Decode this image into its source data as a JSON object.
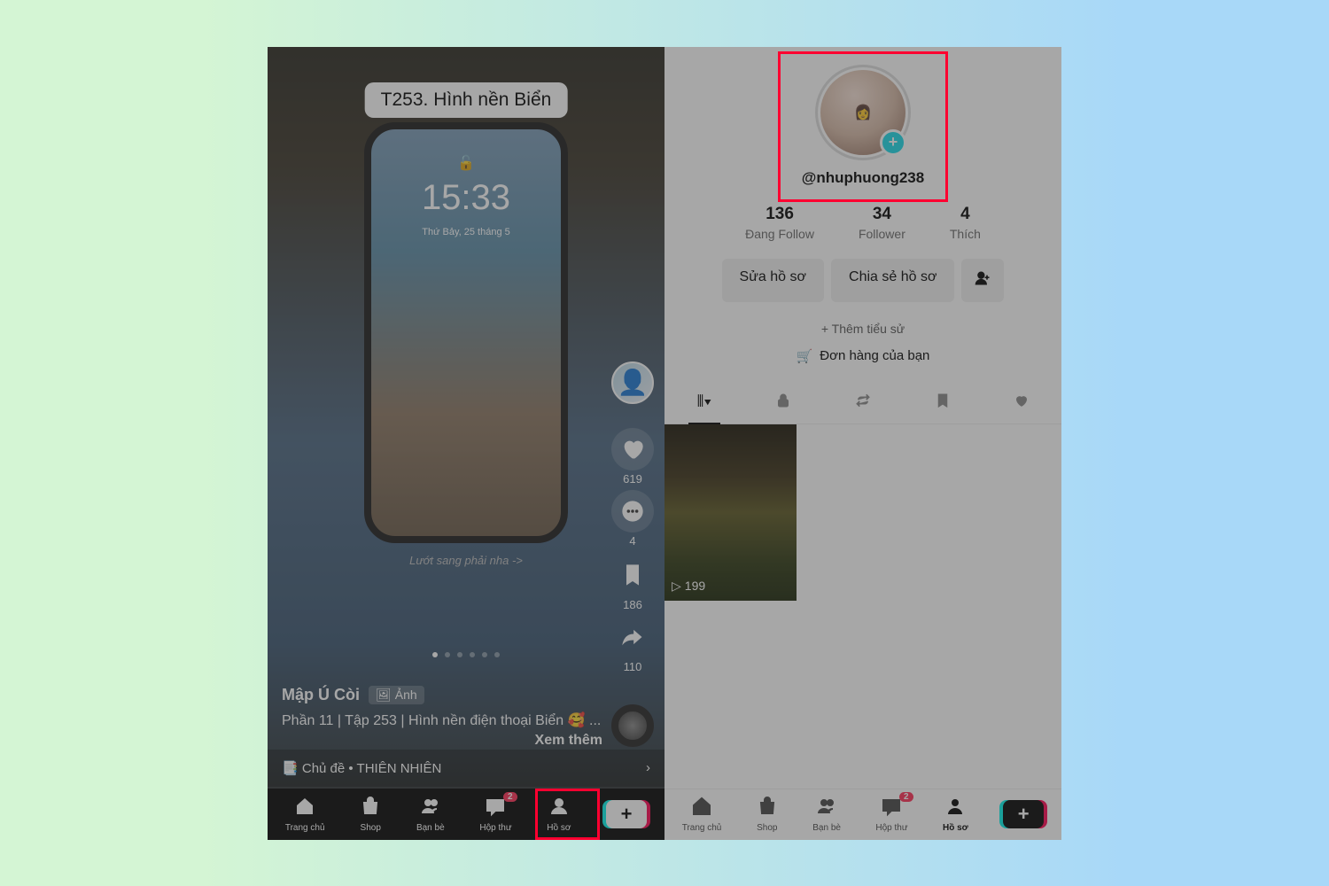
{
  "left": {
    "title_pill": "T253. Hình nền Biển",
    "phone": {
      "time": "15:33",
      "date": "Thứ Bảy, 25 tháng 5"
    },
    "swipe_hint": "Lướt sang phải nha ->",
    "rail": {
      "likes": "619",
      "comments": "4",
      "saves": "186",
      "shares": "110"
    },
    "caption": {
      "user": "Mập Ú Còi",
      "badge": "Ảnh",
      "text": "Phần 11 | Tập 253 | Hình nền điện thoại Biển 🥰 ...",
      "more": "Xem thêm"
    },
    "topic": "Chủ đề • THIÊN NHIÊN"
  },
  "right": {
    "username": "@nhuphuong238",
    "stats": [
      {
        "num": "136",
        "lbl": "Đang Follow"
      },
      {
        "num": "34",
        "lbl": "Follower"
      },
      {
        "num": "4",
        "lbl": "Thích"
      }
    ],
    "buttons": {
      "edit": "Sửa hồ sơ",
      "share": "Chia sẻ hồ sơ"
    },
    "bio_add": "+ Thêm tiểu sử",
    "orders": "Đơn hàng của bạn",
    "thumb_plays": "199"
  },
  "nav": {
    "home": "Trang chủ",
    "shop": "Shop",
    "friends": "Bạn bè",
    "inbox": "Hộp thư",
    "profile": "Hồ sơ",
    "badge": "2"
  }
}
